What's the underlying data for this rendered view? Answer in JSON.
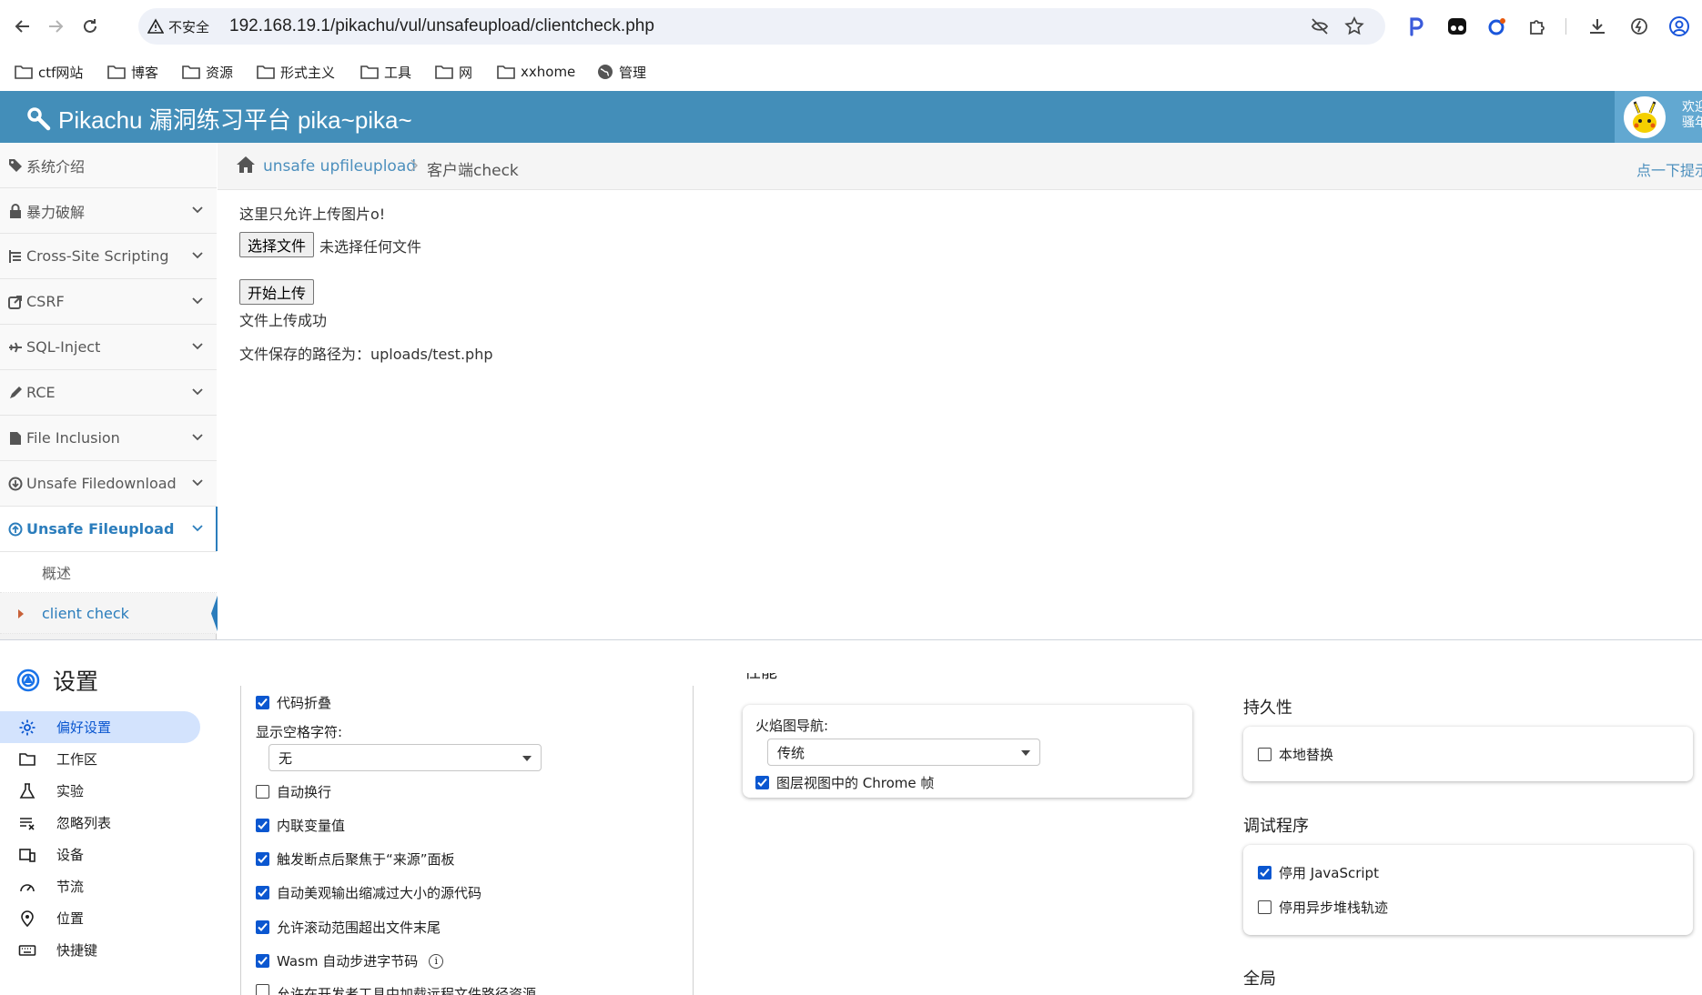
{
  "browser": {
    "security_label": "不安全",
    "url": "192.168.19.1/pikachu/vul/unsafeupload/clientcheck.php",
    "bookmarks": [
      {
        "label": "ctf网站",
        "icon": "folder-icon"
      },
      {
        "label": "博客",
        "icon": "folder-icon"
      },
      {
        "label": "资源",
        "icon": "folder-icon"
      },
      {
        "label": "形式主义",
        "icon": "folder-icon"
      },
      {
        "label": "工具",
        "icon": "folder-icon"
      },
      {
        "label": "网",
        "icon": "folder-icon"
      },
      {
        "label": "xxhome",
        "icon": "folder-icon"
      },
      {
        "label": "管理",
        "icon": "globe-icon"
      }
    ]
  },
  "pikachu": {
    "brand": "Pikachu 漏洞练习平台 pika~pika~",
    "welcome_line1": "欢迎",
    "welcome_line2": "骚年",
    "sidebar": [
      {
        "label": "系统介绍",
        "icon": "tags-icon",
        "expandable": false
      },
      {
        "label": "暴力破解",
        "icon": "lock-icon",
        "expandable": true
      },
      {
        "label": "Cross-Site Scripting",
        "icon": "list-icon",
        "expandable": true
      },
      {
        "label": "CSRF",
        "icon": "share-icon",
        "expandable": true
      },
      {
        "label": "SQL-Inject",
        "icon": "plane-icon",
        "expandable": true
      },
      {
        "label": "RCE",
        "icon": "pencil-icon",
        "expandable": true
      },
      {
        "label": "File Inclusion",
        "icon": "file-icon",
        "expandable": true
      },
      {
        "label": "Unsafe Filedownload",
        "icon": "download-icon",
        "expandable": true
      },
      {
        "label": "Unsafe Fileupload",
        "icon": "upload-icon",
        "expandable": true,
        "active": true
      }
    ],
    "submenu": [
      "概述",
      "client check"
    ],
    "breadcrumb": {
      "link": "unsafe upfileupload",
      "current": "客户端check",
      "hint": "点一下提示"
    },
    "content": {
      "notice": "这里只允许上传图片o!",
      "choose_file": "选择文件",
      "no_file": "未选择任何文件",
      "upload_button": "开始上传",
      "success": "文件上传成功",
      "path": "文件保存的路径为：uploads/test.php"
    }
  },
  "devtools": {
    "title": "设置",
    "nav": [
      {
        "label": "偏好设置",
        "icon": "gear-icon",
        "active": true
      },
      {
        "label": "工作区",
        "icon": "folder-icon"
      },
      {
        "label": "实验",
        "icon": "flask-icon"
      },
      {
        "label": "忽略列表",
        "icon": "ignore-list-icon"
      },
      {
        "label": "设备",
        "icon": "devices-icon"
      },
      {
        "label": "节流",
        "icon": "speedometer-icon"
      },
      {
        "label": "位置",
        "icon": "location-pin-icon"
      },
      {
        "label": "快捷键",
        "icon": "keyboard-icon"
      }
    ],
    "sources": {
      "code_folding": {
        "label": "代码折叠",
        "checked": true
      },
      "whitespace_label": "显示空格字符:",
      "whitespace_value": "无",
      "options": [
        {
          "label": "自动换行",
          "checked": false
        },
        {
          "label": "内联变量值",
          "checked": true
        },
        {
          "label": "触发断点后聚焦于“来源”面板",
          "checked": true
        },
        {
          "label": "自动美观输出缩减过大小的源代码",
          "checked": true
        },
        {
          "label": "允许滚动范围超出文件末尾",
          "checked": true
        },
        {
          "label": "Wasm 自动步进字节码",
          "checked": true
        },
        {
          "label": "允许在开发者工具中加载远程文件路径资源",
          "checked": false
        }
      ]
    },
    "performance": {
      "heading_partial": "性能",
      "flamechart_label": "火焰图导航:",
      "flamechart_value": "传统",
      "chrome_frames": {
        "label": "图层视图中的 Chrome 帧",
        "checked": true
      }
    },
    "persistence": {
      "heading": "持久性",
      "local_overrides": {
        "label": "本地替换",
        "checked": false
      }
    },
    "debugger": {
      "heading": "调试程序",
      "disable_js": {
        "label": "停用 JavaScript",
        "checked": true
      },
      "disable_async": {
        "label": "停用异步堆栈轨迹",
        "checked": false
      }
    },
    "global_heading": "全局"
  }
}
